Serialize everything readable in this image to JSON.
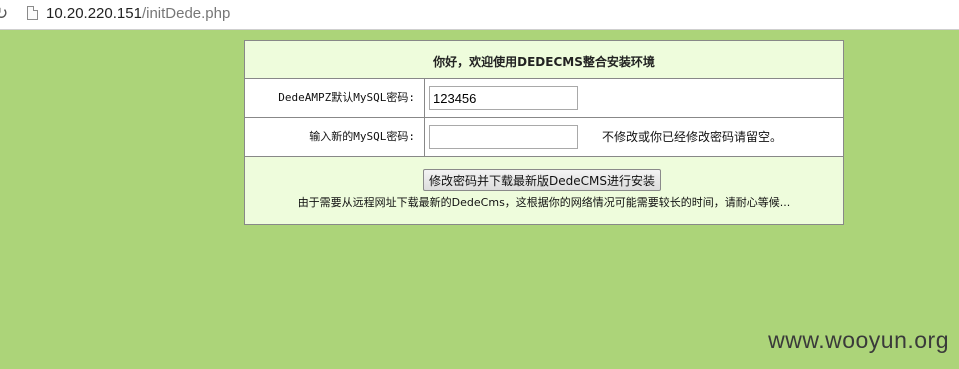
{
  "browser": {
    "url_host": "10.20.220.151",
    "url_path": "/initDede.php",
    "reload_icon": "reload-icon",
    "page_icon": "page-icon"
  },
  "form": {
    "title": "你好，欢迎使用DEDECMS整合安装环境",
    "current_password_label": "DedeAMPZ默认MySQL密码:",
    "current_password_value": "123456",
    "new_password_label": "输入新的MySQL密码:",
    "new_password_value": "",
    "new_password_hint": "不修改或你已经修改密码请留空。",
    "submit_label": "修改密码并下载最新版DedeCMS进行安装",
    "notice": "由于需要从远程网址下载最新的DedeCms，这根据你的网络情况可能需要较长的时间，请耐心等候..."
  },
  "watermark": "www.wooyun.org",
  "colors": {
    "page_background": "#acd479",
    "panel_header_background": "#eefcdc",
    "border": "#888888"
  }
}
